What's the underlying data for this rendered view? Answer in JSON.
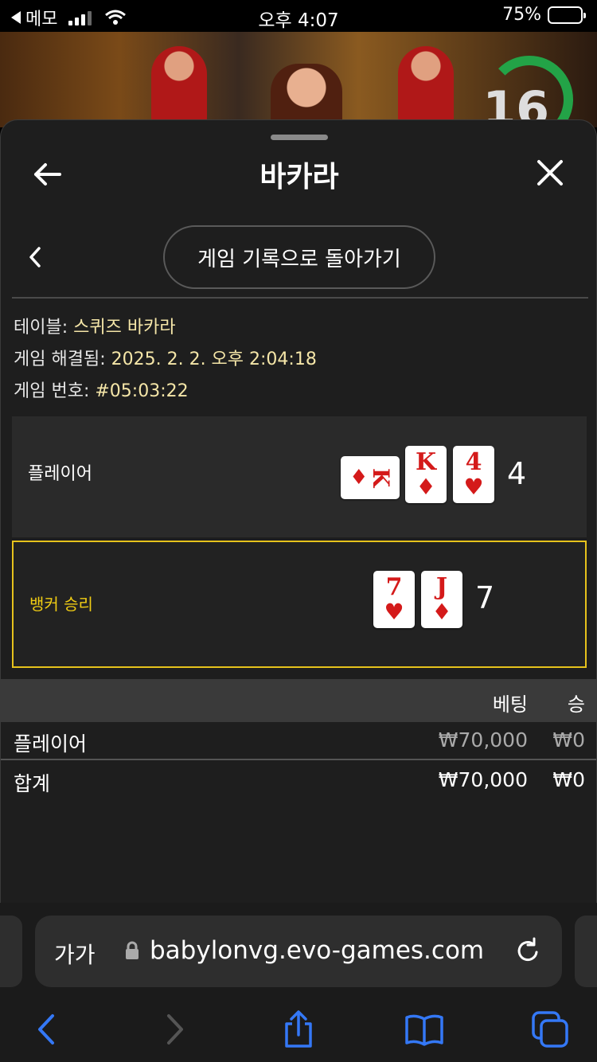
{
  "status_bar": {
    "back_app": "메모",
    "time": "오후 4:07",
    "battery": "75%",
    "battery_level": 0.75
  },
  "video": {
    "timer": "16"
  },
  "sheet": {
    "title": "바카라",
    "history_button": "게임 기록으로 돌아가기"
  },
  "info": {
    "table_label": "테이블:",
    "table_value": "스퀴즈 바카라",
    "resolved_label": "게임 해결됨:",
    "resolved_value": "2025. 2. 2. 오후 2:04:18",
    "game_no_label": "게임 번호:",
    "game_no_value": "#05:03:22"
  },
  "result": {
    "player": {
      "label": "플레이어",
      "score": "4",
      "cards": [
        {
          "rank": "K",
          "suit": "♦",
          "orientation": "horizontal"
        },
        {
          "rank": "K",
          "suit": "♦",
          "orientation": "vertical"
        },
        {
          "rank": "4",
          "suit": "♥",
          "orientation": "vertical"
        }
      ]
    },
    "banker": {
      "label": "뱅커 승리",
      "score": "7",
      "cards": [
        {
          "rank": "7",
          "suit": "♥",
          "orientation": "vertical"
        },
        {
          "rank": "J",
          "suit": "♦",
          "orientation": "vertical"
        }
      ]
    }
  },
  "bets_table": {
    "headers": {
      "bet": "베팅",
      "win": "승"
    },
    "rows": [
      {
        "name": "플레이어",
        "bet": "₩70,000",
        "win": "₩0"
      }
    ],
    "total": {
      "name": "합계",
      "bet": "₩70,000",
      "win": "₩0"
    }
  },
  "browser": {
    "aa": "가가",
    "url": "babylonvg.evo-games.com"
  },
  "colors": {
    "accent_yellow": "#f0cc14",
    "card_red": "#d41a1a",
    "ios_blue": "#3478f6",
    "timer_green": "#23a347"
  }
}
